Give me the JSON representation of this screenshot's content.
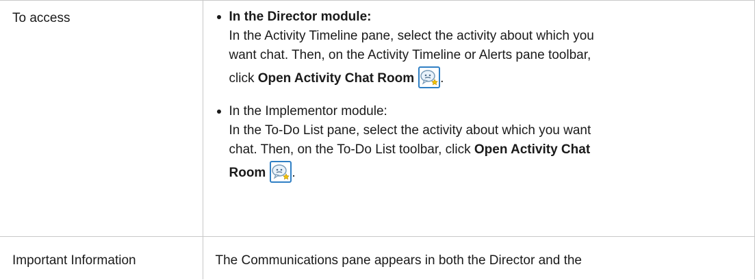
{
  "access": {
    "label": "To access",
    "director": {
      "heading": "In the Director module:",
      "line1": "In the Activity Timeline pane, select the activity about which you",
      "line2": "want chat. Then, on the Activity Timeline or Alerts pane toolbar,",
      "click_word": "click",
      "button_name": "Open Activity Chat Room",
      "end": ".",
      "icon": "chat-room-icon"
    },
    "implementor": {
      "heading": "In the Implementor module:",
      "line1": "In the To-Do List pane, select the activity about which you want",
      "line2_prefix": "chat. Then, on the To-Do List toolbar, click",
      "button_name_part1": "Open Activity Chat",
      "button_name_part2": "Room",
      "end": ".",
      "icon": "chat-room-icon"
    }
  },
  "important": {
    "label": "Important Information",
    "text": "The Communications pane appears in both the Director and the"
  },
  "colors": {
    "border": "#c8c8c8",
    "text": "#1a1a1a",
    "icon_blue": "#2f7fc4",
    "icon_bubble": "#e9f2fa"
  }
}
